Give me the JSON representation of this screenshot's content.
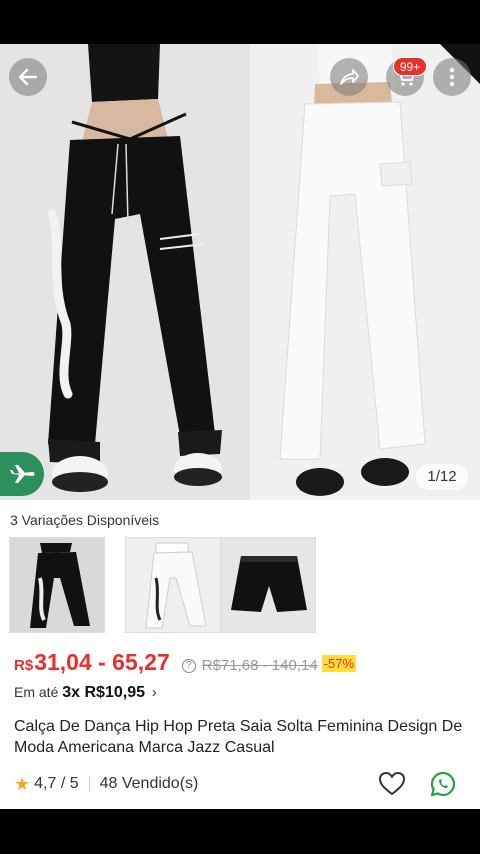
{
  "header": {
    "cart_badge": "99+",
    "icons": [
      "back-arrow-icon",
      "share-icon",
      "cart-icon",
      "more-vertical-icon"
    ]
  },
  "gallery": {
    "counter": "1/12",
    "badge_icon": "airplane-icon",
    "badge_color": "#2d8f5c",
    "pants_colors": [
      "#111111",
      "#f6f6f6"
    ]
  },
  "variations": {
    "title": "3 Variações Disponíveis",
    "items": [
      {
        "name": "Preto"
      },
      {
        "name": "Branco"
      },
      {
        "name": "Shorts Preto"
      }
    ]
  },
  "price": {
    "currency": "R$",
    "range": "31,04 - 65,27",
    "original": "R$71,68 - 140,14",
    "discount": "-57%",
    "accent": "#e8302a",
    "discount_bg": "#ffde38"
  },
  "installment": {
    "prefix": "Em até",
    "value": "3x R$10,95",
    "chevron": "›"
  },
  "product": {
    "title": "Calça De Dança Hip Hop Preta Saia Solta Feminina Design De Moda Americana Marca Jazz Casual"
  },
  "rating": {
    "star": "★",
    "value": "4,7 / 5",
    "sold": "48 Vendido(s)"
  },
  "actions": {
    "icons": [
      "heart-icon",
      "whatsapp-icon"
    ],
    "whatsapp_color": "#25a244"
  }
}
